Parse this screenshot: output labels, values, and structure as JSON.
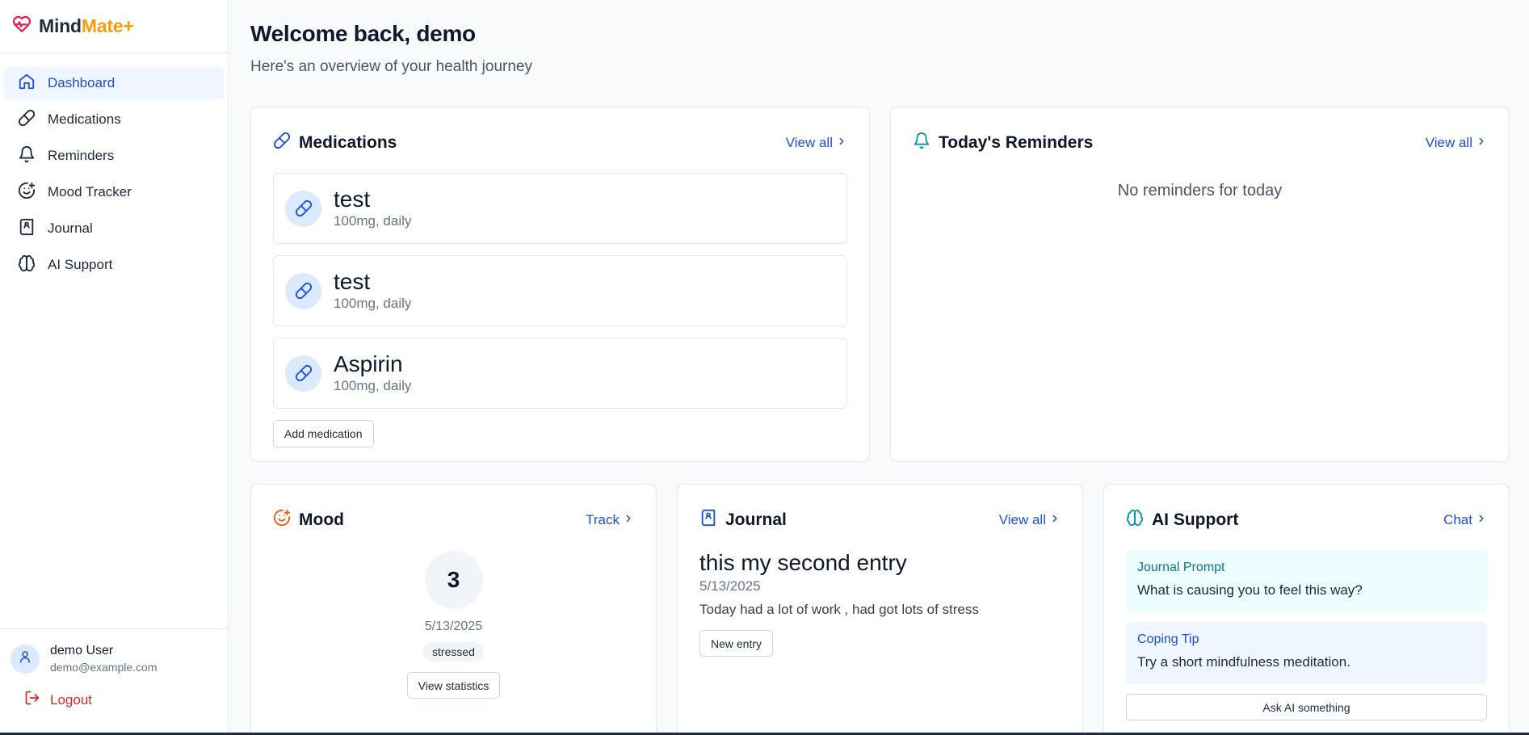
{
  "brand": {
    "name_part1": "Mind",
    "name_part2": "Mate+"
  },
  "nav": [
    {
      "label": "Dashboard",
      "icon": "home-icon",
      "active": true
    },
    {
      "label": "Medications",
      "icon": "pill-icon"
    },
    {
      "label": "Reminders",
      "icon": "bell-icon"
    },
    {
      "label": "Mood Tracker",
      "icon": "smile-plus-icon"
    },
    {
      "label": "Journal",
      "icon": "book-icon"
    },
    {
      "label": "AI Support",
      "icon": "brain-icon"
    }
  ],
  "user": {
    "name": "demo User",
    "email": "demo@example.com",
    "logout_label": "Logout"
  },
  "header": {
    "title": "Welcome back, demo",
    "subtitle": "Here's an overview of your health journey"
  },
  "medications": {
    "title": "Medications",
    "link": "View all",
    "items": [
      {
        "name": "test",
        "dose": "100mg, daily"
      },
      {
        "name": "test",
        "dose": "100mg, daily"
      },
      {
        "name": "Aspirin",
        "dose": "100mg, daily"
      }
    ],
    "add_button": "Add medication"
  },
  "reminders": {
    "title": "Today's Reminders",
    "link": "View all",
    "empty": "No reminders for today"
  },
  "mood": {
    "title": "Mood",
    "link": "Track",
    "score": "3",
    "date": "5/13/2025",
    "label": "stressed",
    "button": "View statistics"
  },
  "journal": {
    "title": "Journal",
    "link": "View all",
    "entry_title": "this my second entry",
    "entry_date": "5/13/2025",
    "entry_text": "Today had a lot of work , had got lots of stress",
    "button": "New entry"
  },
  "ai": {
    "title": "AI Support",
    "link": "Chat",
    "prompt_label": "Journal Prompt",
    "prompt_text": "What is causing you to feel this way?",
    "tip_label": "Coping Tip",
    "tip_text": "Try a short mindfulness meditation.",
    "button": "Ask AI something"
  },
  "colors": {
    "primary": "#1d4ed8",
    "accent": "#f59e0b",
    "brand_heart": "#e11d48",
    "teal": "#0891b2",
    "orange": "#ea580c",
    "danger": "#dc2626"
  }
}
